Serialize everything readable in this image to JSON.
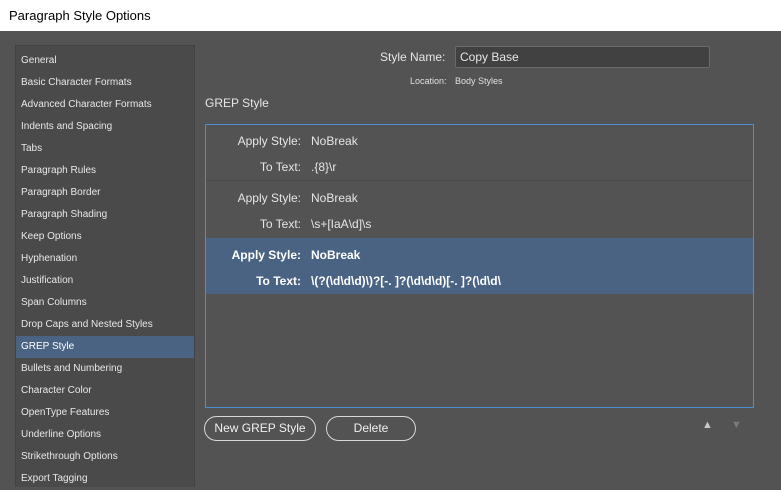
{
  "window": {
    "title": "Paragraph Style Options"
  },
  "sidebar": {
    "items": [
      {
        "label": "General"
      },
      {
        "label": "Basic Character Formats"
      },
      {
        "label": "Advanced Character Formats"
      },
      {
        "label": "Indents and Spacing"
      },
      {
        "label": "Tabs"
      },
      {
        "label": "Paragraph Rules"
      },
      {
        "label": "Paragraph Border"
      },
      {
        "label": "Paragraph Shading"
      },
      {
        "label": "Keep Options"
      },
      {
        "label": "Hyphenation"
      },
      {
        "label": "Justification"
      },
      {
        "label": "Span Columns"
      },
      {
        "label": "Drop Caps and Nested Styles"
      },
      {
        "label": "GREP Style"
      },
      {
        "label": "Bullets and Numbering"
      },
      {
        "label": "Character Color"
      },
      {
        "label": "OpenType Features"
      },
      {
        "label": "Underline Options"
      },
      {
        "label": "Strikethrough Options"
      },
      {
        "label": "Export Tagging"
      }
    ],
    "selected": "GREP Style"
  },
  "header": {
    "style_name_label": "Style Name:",
    "style_name_value": "Copy Base",
    "location_label": "Location:",
    "location_value": "Body Styles"
  },
  "section": {
    "title": "GREP Style"
  },
  "grep": {
    "apply_label": "Apply Style:",
    "text_label": "To Text:",
    "rules": [
      {
        "apply_style": "NoBreak",
        "to_text": ".{8}\\r"
      },
      {
        "apply_style": "NoBreak",
        "to_text": "\\s+[IaA\\d]\\s"
      },
      {
        "apply_style": "NoBreak",
        "to_text": "\\(?(\\d\\d\\d)\\)?[-. ]?(\\d\\d\\d)[-. ]?(\\d\\d\\"
      }
    ],
    "selected_index": 2
  },
  "buttons": {
    "new_grep_style": "New GREP Style",
    "delete": "Delete"
  },
  "icons": {
    "move_up": "triangle-up-icon",
    "move_down": "triangle-down-icon"
  },
  "colors": {
    "selection": "#4a6382",
    "focus_border": "#4a90d9",
    "dialog_bg": "#535353"
  }
}
